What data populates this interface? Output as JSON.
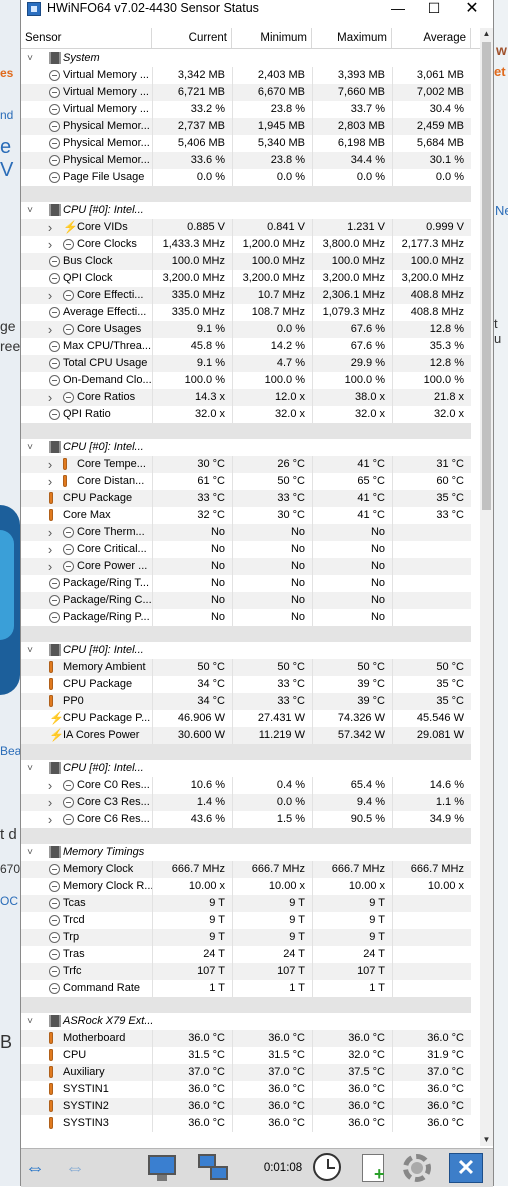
{
  "window": {
    "title": "HWiNFO64 v7.02-4430 Sensor Status"
  },
  "columns": {
    "sensor": "Sensor",
    "current": "Current",
    "minimum": "Minimum",
    "maximum": "Maximum",
    "average": "Average"
  },
  "rows": [
    {
      "kind": "group",
      "icon": "chip",
      "name": "System"
    },
    {
      "kind": "data",
      "icon": "clock",
      "name": "Virtual Memory ...",
      "cur": "3,342 MB",
      "min": "2,403 MB",
      "max": "3,393 MB",
      "avg": "3,061 MB"
    },
    {
      "kind": "data",
      "icon": "clock",
      "name": "Virtual Memory ...",
      "cur": "6,721 MB",
      "min": "6,670 MB",
      "max": "7,660 MB",
      "avg": "7,002 MB"
    },
    {
      "kind": "data",
      "icon": "clock",
      "name": "Virtual Memory ...",
      "cur": "33.2 %",
      "min": "23.8 %",
      "max": "33.7 %",
      "avg": "30.4 %"
    },
    {
      "kind": "data",
      "icon": "clock",
      "name": "Physical Memor...",
      "cur": "2,737 MB",
      "min": "1,945 MB",
      "max": "2,803 MB",
      "avg": "2,459 MB"
    },
    {
      "kind": "data",
      "icon": "clock",
      "name": "Physical Memor...",
      "cur": "5,406 MB",
      "min": "5,340 MB",
      "max": "6,198 MB",
      "avg": "5,684 MB"
    },
    {
      "kind": "data",
      "icon": "clock",
      "name": "Physical Memor...",
      "cur": "33.6 %",
      "min": "23.8 %",
      "max": "34.4 %",
      "avg": "30.1 %"
    },
    {
      "kind": "data",
      "icon": "clock",
      "name": "Page File Usage",
      "cur": "0.0 %",
      "min": "0.0 %",
      "max": "0.0 %",
      "avg": "0.0 %"
    },
    {
      "kind": "spacer"
    },
    {
      "kind": "group",
      "icon": "chip",
      "name": "CPU [#0]: Intel..."
    },
    {
      "kind": "data",
      "icon": "volt",
      "exp": true,
      "name": "Core VIDs",
      "cur": "0.885 V",
      "min": "0.841 V",
      "max": "1.231 V",
      "avg": "0.999 V"
    },
    {
      "kind": "data",
      "icon": "clock",
      "exp": true,
      "name": "Core Clocks",
      "cur": "1,433.3 MHz",
      "min": "1,200.0 MHz",
      "max": "3,800.0 MHz",
      "avg": "2,177.3 MHz"
    },
    {
      "kind": "data",
      "icon": "clock",
      "name": "Bus Clock",
      "cur": "100.0 MHz",
      "min": "100.0 MHz",
      "max": "100.0 MHz",
      "avg": "100.0 MHz"
    },
    {
      "kind": "data",
      "icon": "clock",
      "name": "QPI Clock",
      "cur": "3,200.0 MHz",
      "min": "3,200.0 MHz",
      "max": "3,200.0 MHz",
      "avg": "3,200.0 MHz"
    },
    {
      "kind": "data",
      "icon": "clock",
      "exp": true,
      "name": "Core Effecti...",
      "cur": "335.0 MHz",
      "min": "10.7 MHz",
      "max": "2,306.1 MHz",
      "avg": "408.8 MHz"
    },
    {
      "kind": "data",
      "icon": "clock",
      "name": "Average Effecti...",
      "cur": "335.0 MHz",
      "min": "108.7 MHz",
      "max": "1,079.3 MHz",
      "avg": "408.8 MHz"
    },
    {
      "kind": "data",
      "icon": "clock",
      "exp": true,
      "name": "Core Usages",
      "cur": "9.1 %",
      "min": "0.0 %",
      "max": "67.6 %",
      "avg": "12.8 %"
    },
    {
      "kind": "data",
      "icon": "clock",
      "name": "Max CPU/Threa...",
      "cur": "45.8 %",
      "min": "14.2 %",
      "max": "67.6 %",
      "avg": "35.3 %"
    },
    {
      "kind": "data",
      "icon": "clock",
      "name": "Total CPU Usage",
      "cur": "9.1 %",
      "min": "4.7 %",
      "max": "29.9 %",
      "avg": "12.8 %"
    },
    {
      "kind": "data",
      "icon": "clock",
      "name": "On-Demand Clo...",
      "cur": "100.0 %",
      "min": "100.0 %",
      "max": "100.0 %",
      "avg": "100.0 %"
    },
    {
      "kind": "data",
      "icon": "clock",
      "exp": true,
      "name": "Core Ratios",
      "cur": "14.3 x",
      "min": "12.0 x",
      "max": "38.0 x",
      "avg": "21.8 x"
    },
    {
      "kind": "data",
      "icon": "clock",
      "name": "QPI Ratio",
      "cur": "32.0 x",
      "min": "32.0 x",
      "max": "32.0 x",
      "avg": "32.0 x"
    },
    {
      "kind": "spacer"
    },
    {
      "kind": "group",
      "icon": "chip",
      "name": "CPU [#0]: Intel..."
    },
    {
      "kind": "data",
      "icon": "therm",
      "exp": true,
      "name": "Core Tempe...",
      "cur": "30 °C",
      "min": "26 °C",
      "max": "41 °C",
      "avg": "31 °C"
    },
    {
      "kind": "data",
      "icon": "therm",
      "exp": true,
      "name": "Core Distan...",
      "cur": "61 °C",
      "min": "50 °C",
      "max": "65 °C",
      "avg": "60 °C"
    },
    {
      "kind": "data",
      "icon": "therm",
      "name": "CPU Package",
      "cur": "33 °C",
      "min": "33 °C",
      "max": "41 °C",
      "avg": "35 °C"
    },
    {
      "kind": "data",
      "icon": "therm",
      "name": "Core Max",
      "cur": "32 °C",
      "min": "30 °C",
      "max": "41 °C",
      "avg": "33 °C"
    },
    {
      "kind": "data",
      "icon": "clock",
      "exp": true,
      "name": "Core Therm...",
      "cur": "No",
      "min": "No",
      "max": "No",
      "avg": ""
    },
    {
      "kind": "data",
      "icon": "clock",
      "exp": true,
      "name": "Core Critical...",
      "cur": "No",
      "min": "No",
      "max": "No",
      "avg": ""
    },
    {
      "kind": "data",
      "icon": "clock",
      "exp": true,
      "name": "Core Power ...",
      "cur": "No",
      "min": "No",
      "max": "No",
      "avg": ""
    },
    {
      "kind": "data",
      "icon": "clock",
      "name": "Package/Ring T...",
      "cur": "No",
      "min": "No",
      "max": "No",
      "avg": ""
    },
    {
      "kind": "data",
      "icon": "clock",
      "name": "Package/Ring C...",
      "cur": "No",
      "min": "No",
      "max": "No",
      "avg": ""
    },
    {
      "kind": "data",
      "icon": "clock",
      "name": "Package/Ring P...",
      "cur": "No",
      "min": "No",
      "max": "No",
      "avg": ""
    },
    {
      "kind": "spacer"
    },
    {
      "kind": "group",
      "icon": "chip",
      "name": "CPU [#0]: Intel..."
    },
    {
      "kind": "data",
      "icon": "therm",
      "name": "Memory Ambient",
      "cur": "50 °C",
      "min": "50 °C",
      "max": "50 °C",
      "avg": "50 °C"
    },
    {
      "kind": "data",
      "icon": "therm",
      "name": "CPU Package",
      "cur": "34 °C",
      "min": "33 °C",
      "max": "39 °C",
      "avg": "35 °C"
    },
    {
      "kind": "data",
      "icon": "therm",
      "name": "PP0",
      "cur": "34 °C",
      "min": "33 °C",
      "max": "39 °C",
      "avg": "35 °C"
    },
    {
      "kind": "data",
      "icon": "volt",
      "name": "CPU Package P...",
      "cur": "46.906 W",
      "min": "27.431 W",
      "max": "74.326 W",
      "avg": "45.546 W"
    },
    {
      "kind": "data",
      "icon": "volt",
      "name": "IA Cores Power",
      "cur": "30.600 W",
      "min": "11.219 W",
      "max": "57.342 W",
      "avg": "29.081 W"
    },
    {
      "kind": "spacer"
    },
    {
      "kind": "group",
      "icon": "chip",
      "name": "CPU [#0]: Intel..."
    },
    {
      "kind": "data",
      "icon": "clock",
      "exp": true,
      "name": "Core C0 Res...",
      "cur": "10.6 %",
      "min": "0.4 %",
      "max": "65.4 %",
      "avg": "14.6 %"
    },
    {
      "kind": "data",
      "icon": "clock",
      "exp": true,
      "name": "Core C3 Res...",
      "cur": "1.4 %",
      "min": "0.0 %",
      "max": "9.4 %",
      "avg": "1.1 %"
    },
    {
      "kind": "data",
      "icon": "clock",
      "exp": true,
      "name": "Core C6 Res...",
      "cur": "43.6 %",
      "min": "1.5 %",
      "max": "90.5 %",
      "avg": "34.9 %"
    },
    {
      "kind": "spacer"
    },
    {
      "kind": "group",
      "icon": "chip",
      "name": "Memory Timings"
    },
    {
      "kind": "data",
      "icon": "clock",
      "name": "Memory Clock",
      "cur": "666.7 MHz",
      "min": "666.7 MHz",
      "max": "666.7 MHz",
      "avg": "666.7 MHz"
    },
    {
      "kind": "data",
      "icon": "clock",
      "name": "Memory Clock R...",
      "cur": "10.00 x",
      "min": "10.00 x",
      "max": "10.00 x",
      "avg": "10.00 x"
    },
    {
      "kind": "data",
      "icon": "clock",
      "name": "Tcas",
      "cur": "9 T",
      "min": "9 T",
      "max": "9 T",
      "avg": ""
    },
    {
      "kind": "data",
      "icon": "clock",
      "name": "Trcd",
      "cur": "9 T",
      "min": "9 T",
      "max": "9 T",
      "avg": ""
    },
    {
      "kind": "data",
      "icon": "clock",
      "name": "Trp",
      "cur": "9 T",
      "min": "9 T",
      "max": "9 T",
      "avg": ""
    },
    {
      "kind": "data",
      "icon": "clock",
      "name": "Tras",
      "cur": "24 T",
      "min": "24 T",
      "max": "24 T",
      "avg": ""
    },
    {
      "kind": "data",
      "icon": "clock",
      "name": "Trfc",
      "cur": "107 T",
      "min": "107 T",
      "max": "107 T",
      "avg": ""
    },
    {
      "kind": "data",
      "icon": "clock",
      "name": "Command Rate",
      "cur": "1 T",
      "min": "1 T",
      "max": "1 T",
      "avg": ""
    },
    {
      "kind": "spacer"
    },
    {
      "kind": "group",
      "icon": "chip",
      "name": "ASRock X79 Ext..."
    },
    {
      "kind": "data",
      "icon": "therm",
      "name": "Motherboard",
      "cur": "36.0 °C",
      "min": "36.0 °C",
      "max": "36.0 °C",
      "avg": "36.0 °C"
    },
    {
      "kind": "data",
      "icon": "therm",
      "name": "CPU",
      "cur": "31.5 °C",
      "min": "31.5 °C",
      "max": "32.0 °C",
      "avg": "31.9 °C"
    },
    {
      "kind": "data",
      "icon": "therm",
      "name": "Auxiliary",
      "cur": "37.0 °C",
      "min": "37.0 °C",
      "max": "37.5 °C",
      "avg": "37.0 °C"
    },
    {
      "kind": "data",
      "icon": "therm",
      "name": "SYSTIN1",
      "cur": "36.0 °C",
      "min": "36.0 °C",
      "max": "36.0 °C",
      "avg": "36.0 °C"
    },
    {
      "kind": "data",
      "icon": "therm",
      "name": "SYSTIN2",
      "cur": "36.0 °C",
      "min": "36.0 °C",
      "max": "36.0 °C",
      "avg": "36.0 °C"
    },
    {
      "kind": "data",
      "icon": "therm",
      "name": "SYSTIN3",
      "cur": "36.0 °C",
      "min": "36.0 °C",
      "max": "36.0 °C",
      "avg": "36.0 °C"
    }
  ],
  "toolbar": {
    "elapsed_time": "0:01:08"
  },
  "background_fragments": {
    "right_w": "w",
    "right_et": "et",
    "right_ne": "Ne",
    "right_tu": "t u",
    "left_1": "es",
    "left_2": "nd",
    "left_3": "e V",
    "left_4": "ge",
    "left_5": "ree",
    "left_6": "Bea",
    "left_7": "t d",
    "left_8": "670",
    "left_9": "OC",
    "left_10": "B"
  }
}
